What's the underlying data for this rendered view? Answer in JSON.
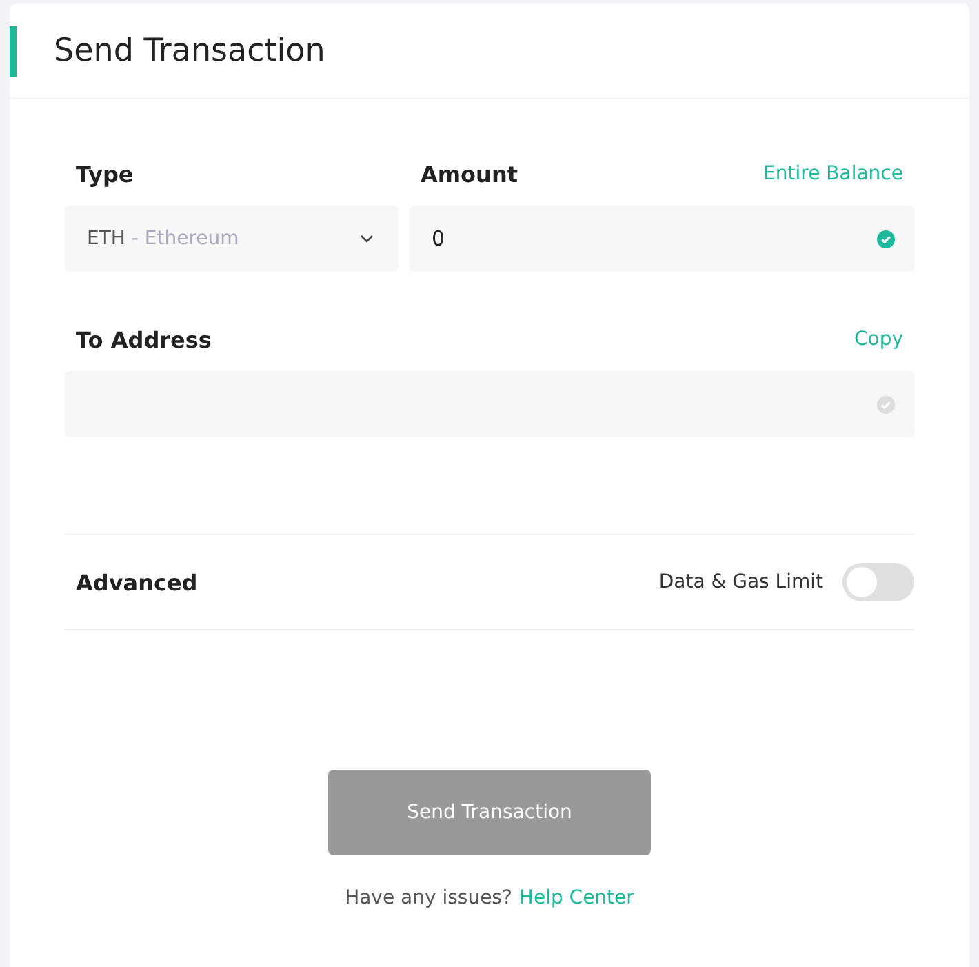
{
  "title": "Send Transaction",
  "type_field": {
    "label": "Type",
    "symbol": "ETH",
    "name": "- Ethereum"
  },
  "amount_field": {
    "label": "Amount",
    "action": "Entire Balance",
    "value": "0",
    "valid": true
  },
  "address_field": {
    "label": "To Address",
    "action": "Copy",
    "valid": false
  },
  "advanced": {
    "label": "Advanced",
    "toggle_label": "Data & Gas Limit",
    "on": false
  },
  "send_button": {
    "label": "Send Transaction",
    "disabled": true
  },
  "help": {
    "text": "Have any issues?",
    "link": "Help Center"
  }
}
